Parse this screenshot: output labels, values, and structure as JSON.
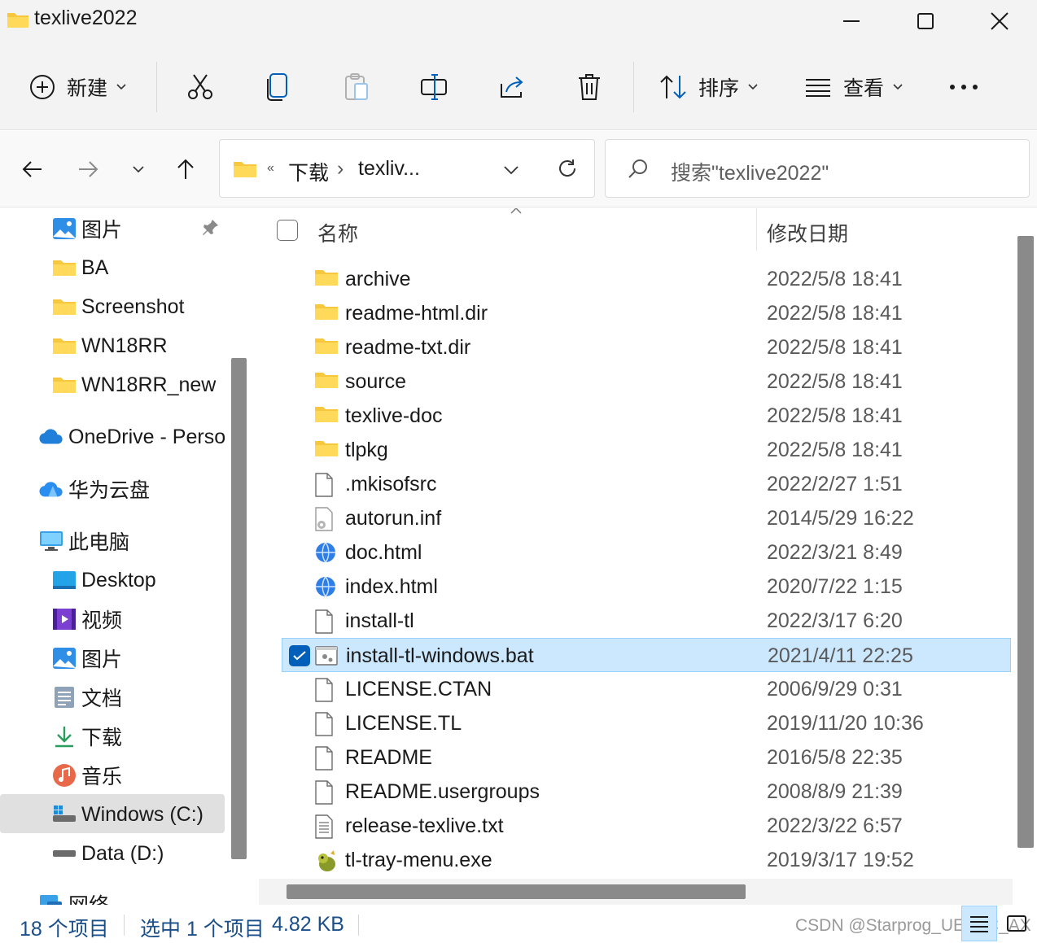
{
  "window": {
    "title": "texlive2022",
    "minimize_icon": "minimize-icon",
    "maximize_icon": "maximize-icon",
    "close_icon": "close-icon"
  },
  "commandbar": {
    "new_label": "新建",
    "sort_label": "排序",
    "view_label": "查看",
    "icons": [
      "plus-circle-icon",
      "cut-icon",
      "copy-icon",
      "paste-icon",
      "rename-icon",
      "share-icon",
      "delete-icon",
      "sort-icon",
      "view-icon",
      "more-icon"
    ]
  },
  "address": {
    "overflow": "«",
    "crumbs": [
      "下载",
      "texliv..."
    ],
    "separator": "›"
  },
  "search": {
    "placeholder": "搜索\"texlive2022\""
  },
  "sidebar": {
    "items": [
      {
        "label": "图片",
        "icon": "pictures-icon",
        "pinned": true
      },
      {
        "label": "BA",
        "icon": "folder-icon"
      },
      {
        "label": "Screenshot",
        "icon": "folder-icon"
      },
      {
        "label": "WN18RR",
        "icon": "folder-icon"
      },
      {
        "label": "WN18RR_new",
        "icon": "folder-icon"
      },
      {
        "label": "OneDrive - Perso",
        "icon": "onedrive-icon"
      },
      {
        "label": "华为云盘",
        "icon": "cloud-icon"
      },
      {
        "label": "此电脑",
        "icon": "pc-icon"
      },
      {
        "label": "Desktop",
        "icon": "desktop-icon"
      },
      {
        "label": "视频",
        "icon": "videos-icon"
      },
      {
        "label": "图片",
        "icon": "pictures-icon"
      },
      {
        "label": "文档",
        "icon": "documents-icon"
      },
      {
        "label": "下载",
        "icon": "downloads-icon"
      },
      {
        "label": "音乐",
        "icon": "music-icon"
      },
      {
        "label": "Windows (C:)",
        "icon": "drive-c-icon",
        "selected": true
      },
      {
        "label": "Data (D:)",
        "icon": "drive-icon"
      },
      {
        "label": "网络",
        "icon": "network-icon"
      }
    ]
  },
  "filelist": {
    "header_name": "名称",
    "header_date": "修改日期",
    "files": [
      {
        "name": "archive",
        "date": "2022/5/8 18:41",
        "type": "folder"
      },
      {
        "name": "readme-html.dir",
        "date": "2022/5/8 18:41",
        "type": "folder"
      },
      {
        "name": "readme-txt.dir",
        "date": "2022/5/8 18:41",
        "type": "folder"
      },
      {
        "name": "source",
        "date": "2022/5/8 18:41",
        "type": "folder"
      },
      {
        "name": "texlive-doc",
        "date": "2022/5/8 18:41",
        "type": "folder"
      },
      {
        "name": "tlpkg",
        "date": "2022/5/8 18:41",
        "type": "folder"
      },
      {
        "name": ".mkisofsrc",
        "date": "2022/2/27 1:51",
        "type": "file"
      },
      {
        "name": "autorun.inf",
        "date": "2014/5/29 16:22",
        "type": "config"
      },
      {
        "name": "doc.html",
        "date": "2022/3/21 8:49",
        "type": "html"
      },
      {
        "name": "index.html",
        "date": "2020/7/22 1:15",
        "type": "html"
      },
      {
        "name": "install-tl",
        "date": "2022/3/17 6:20",
        "type": "file"
      },
      {
        "name": "install-tl-windows.bat",
        "date": "2021/4/11 22:25",
        "type": "batch",
        "selected": true
      },
      {
        "name": "LICENSE.CTAN",
        "date": "2006/9/29 0:31",
        "type": "file"
      },
      {
        "name": "LICENSE.TL",
        "date": "2019/11/20 10:36",
        "type": "file"
      },
      {
        "name": "README",
        "date": "2016/5/8 22:35",
        "type": "file"
      },
      {
        "name": "README.usergroups",
        "date": "2008/8/9 21:39",
        "type": "file"
      },
      {
        "name": "release-texlive.txt",
        "date": "2022/3/22 6:57",
        "type": "text"
      },
      {
        "name": "tl-tray-menu.exe",
        "date": "2019/3/17 19:52",
        "type": "exe"
      }
    ]
  },
  "status": {
    "count": "18 个项目",
    "selected": "选中 1 个项目",
    "size": "4.82 KB",
    "watermark": "CSDN @Starprog_UESTC_AX"
  }
}
